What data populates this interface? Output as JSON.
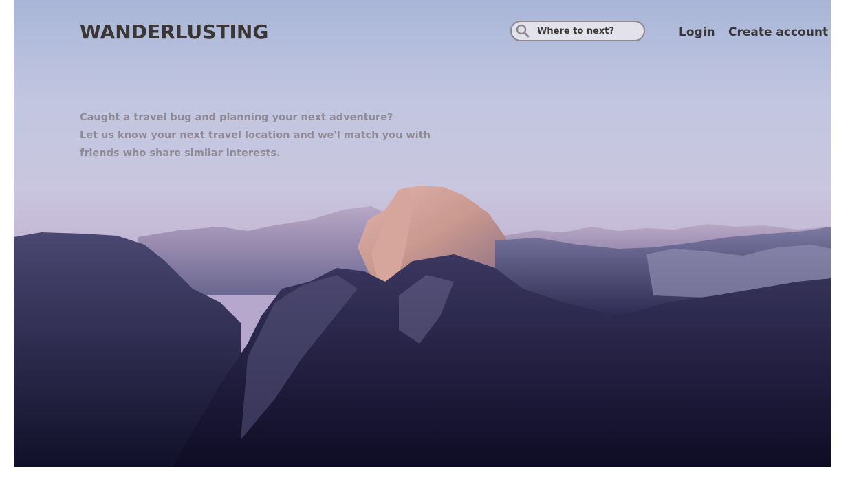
{
  "brand": {
    "name": "WANDERLUSTING"
  },
  "search": {
    "placeholder": "Where to next?",
    "icon": "search-icon"
  },
  "nav": {
    "login_label": "Login",
    "create_account_label": "Create account"
  },
  "hero": {
    "tagline_lines": [
      "Caught a travel bug and planning your next adventure?",
      "Let us know your next travel location and we'l match you with",
      "friends who share similar interests."
    ]
  },
  "colors": {
    "text_dark": "#3a3636",
    "text_muted": "#8f8a95",
    "sky": "#c2c6e0",
    "mountain_dark": "#1c1a3a"
  }
}
